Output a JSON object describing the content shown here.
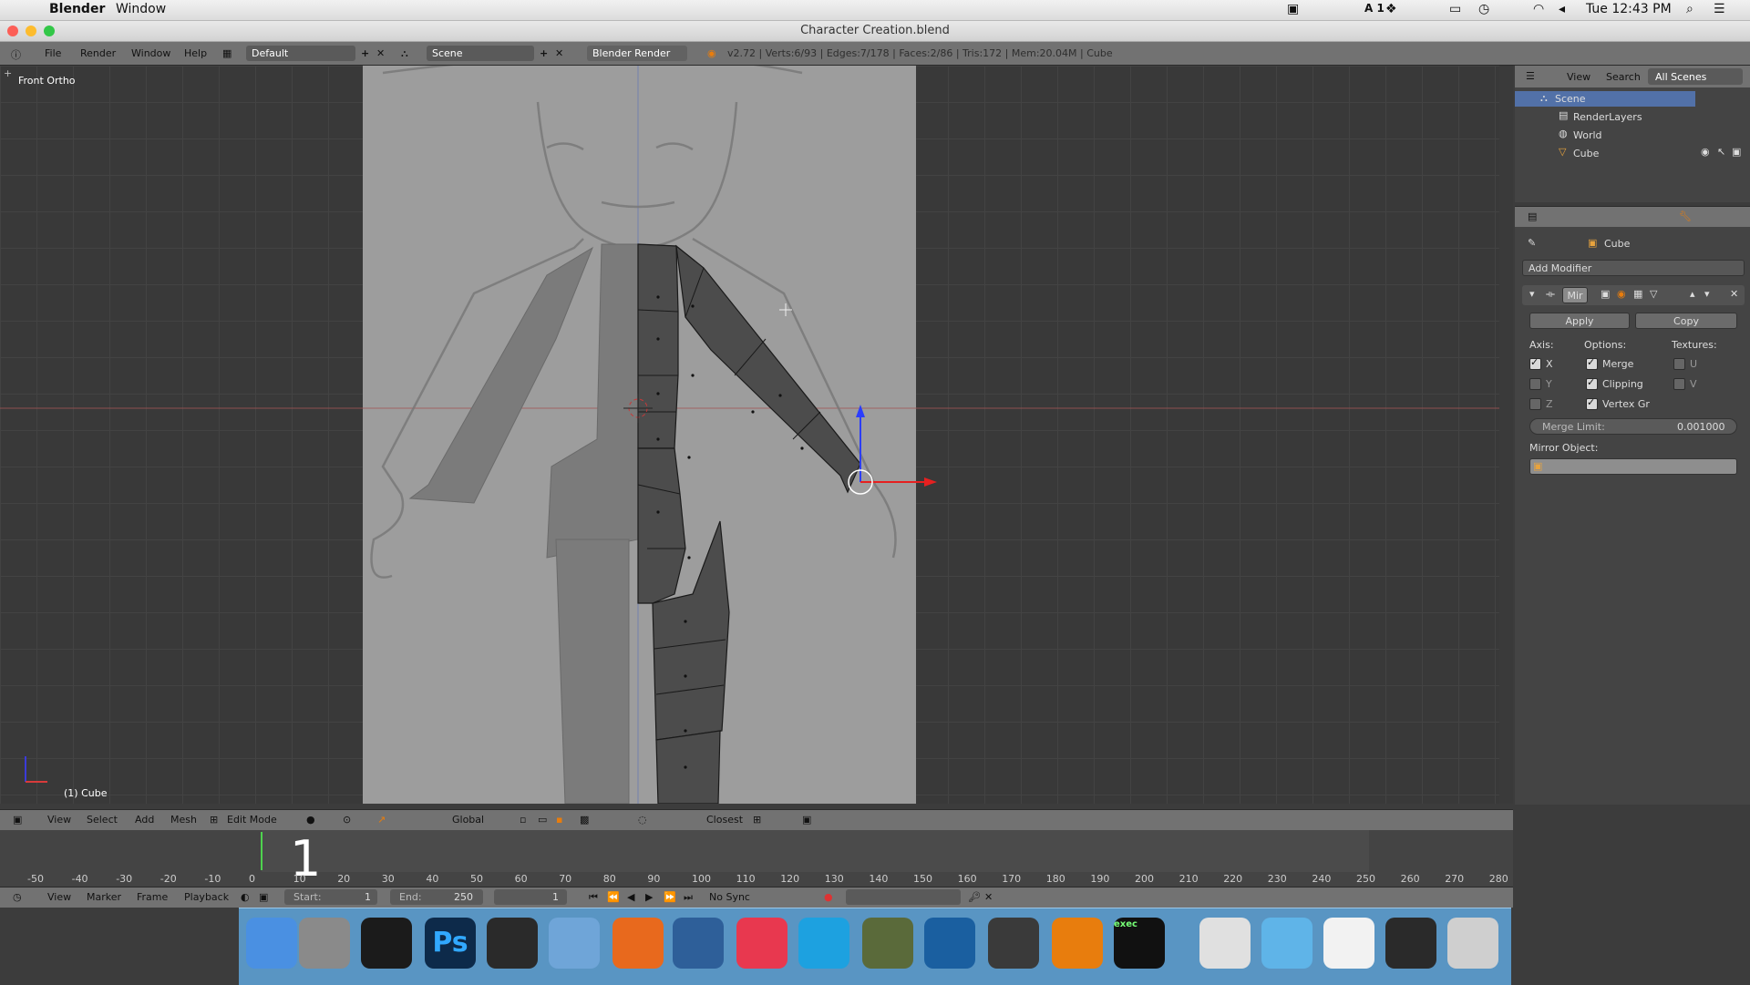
{
  "menubar": {
    "app_name": "Blender",
    "menu_window": "Window",
    "clock": "Tue 12:43 PM",
    "input_indicator": "A 1"
  },
  "window": {
    "title": "Character Creation.blend"
  },
  "info_header": {
    "menus": [
      "File",
      "Render",
      "Window",
      "Help"
    ],
    "screen_layout": "Default",
    "scene": "Scene",
    "render_engine": "Blender Render",
    "stats": "v2.72 | Verts:6/93 | Edges:7/178 | Faces:2/86 | Tris:172 | Mem:20.04M | Cube"
  },
  "viewport": {
    "view_name": "Front Ortho",
    "object_label": "(1) Cube"
  },
  "viewport_header": {
    "menus": [
      "View",
      "Select",
      "Add",
      "Mesh"
    ],
    "mode": "Edit Mode",
    "orientation": "Global",
    "snap": "Closest"
  },
  "timeline": {
    "current_frame": "1",
    "ticks": [
      "-50",
      "-40",
      "-30",
      "-20",
      "-10",
      "0",
      "10",
      "20",
      "30",
      "40",
      "50",
      "60",
      "70",
      "80",
      "90",
      "100",
      "110",
      "120",
      "130",
      "140",
      "150",
      "160",
      "170",
      "180",
      "190",
      "200",
      "210",
      "220",
      "230",
      "240",
      "250",
      "260",
      "270",
      "280"
    ],
    "menus": [
      "View",
      "Marker",
      "Frame",
      "Playback"
    ],
    "start_label": "Start:",
    "start_value": "1",
    "end_label": "End:",
    "end_value": "250",
    "frame_field": "1",
    "sync": "No Sync"
  },
  "outliner": {
    "tabs": [
      "View",
      "Search",
      "All Scenes"
    ],
    "items": [
      {
        "label": "Scene"
      },
      {
        "label": "RenderLayers"
      },
      {
        "label": "World"
      },
      {
        "label": "Cube"
      }
    ]
  },
  "properties": {
    "object_name": "Cube",
    "add_modifier": "Add Modifier",
    "modifier_name": "Mir",
    "apply": "Apply",
    "copy": "Copy",
    "axis_label": "Axis:",
    "options_label": "Options:",
    "textures_label": "Textures:",
    "axis": [
      {
        "label": "X",
        "checked": true
      },
      {
        "label": "Y",
        "checked": false
      },
      {
        "label": "Z",
        "checked": false
      }
    ],
    "options": [
      {
        "label": "Merge",
        "checked": true
      },
      {
        "label": "Clipping",
        "checked": true
      },
      {
        "label": "Vertex Gr",
        "checked": true
      }
    ],
    "textures": [
      {
        "label": "U",
        "checked": false
      },
      {
        "label": "V",
        "checked": false
      }
    ],
    "merge_limit_label": "Merge Limit:",
    "merge_limit_value": "0.001000",
    "mirror_object_label": "Mirror Object:"
  },
  "dock": {
    "apps": [
      "finder-icon",
      "system-preferences-icon",
      "terminal-icon",
      "photoshop-icon",
      "unity-icon",
      "preview-icon",
      "firefox-icon",
      "wireshark-icon",
      "itunes-icon",
      "skype-icon",
      "app-icon",
      "sourcetree-icon",
      "sublime-text-icon",
      "blender-icon",
      "exec-icon",
      "music-folder-icon",
      "folder-icon",
      "document-icon",
      "display-icon",
      "trash-icon"
    ],
    "ps_label": "Ps",
    "exec_label": "exec"
  },
  "colors": {
    "accent_orange": "#e87d0d",
    "selection_blue": "#5680c2",
    "dock_blue": "#5c9ed2"
  }
}
